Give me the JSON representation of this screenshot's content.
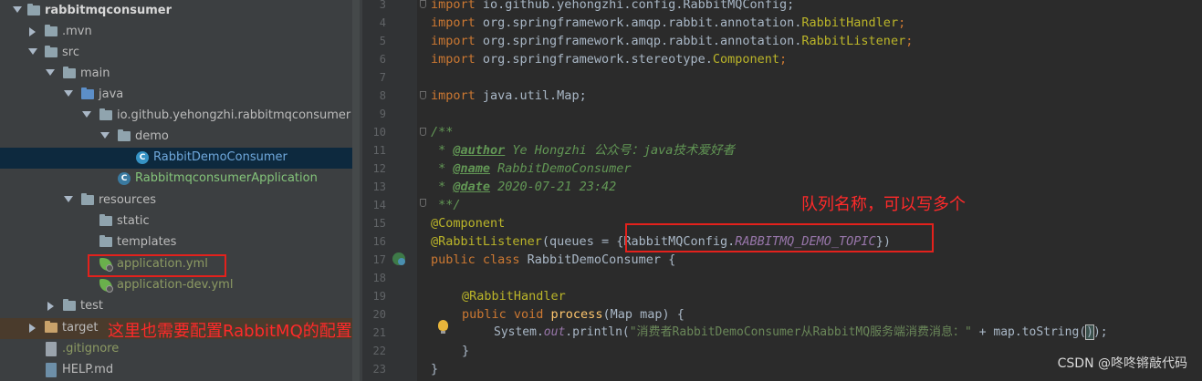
{
  "project_tree": {
    "items": [
      {
        "label": "rabbitmqconsumer",
        "bold": true
      },
      {
        "label": ".mvn"
      },
      {
        "label": "src"
      },
      {
        "label": "main"
      },
      {
        "label": "java"
      },
      {
        "label": "io.github.yehongzhi.rabbitmqconsumer"
      },
      {
        "label": "demo"
      },
      {
        "label": "RabbitDemoConsumer"
      },
      {
        "label": "RabbitmqconsumerApplication"
      },
      {
        "label": "resources"
      },
      {
        "label": "static"
      },
      {
        "label": "templates"
      },
      {
        "label": "application.yml"
      },
      {
        "label": "application-dev.yml"
      },
      {
        "label": "test"
      },
      {
        "label": "target"
      },
      {
        "label": ".gitignore"
      },
      {
        "label": "HELP.md"
      }
    ]
  },
  "editor": {
    "line_numbers": [
      "3",
      "4",
      "5",
      "6",
      "7",
      "8",
      "9",
      "10",
      "11",
      "12",
      "13",
      "14",
      "15",
      "16",
      "17",
      "18",
      "19",
      "20",
      "21",
      "22",
      "23"
    ],
    "code": {
      "l3_kw": "import ",
      "l3_pkg": "io.github.yehongzhi.config.RabbitMQConfig;",
      "l4_kw": "import ",
      "l4_pkg": "org.springframework.amqp.rabbit.annotation.",
      "l4_cls": "RabbitHandler",
      "l4_end": ";",
      "l5_kw": "import ",
      "l5_pkg": "org.springframework.amqp.rabbit.annotation.",
      "l5_cls": "RabbitListener",
      "l5_end": ";",
      "l6_kw": "import ",
      "l6_pkg": "org.springframework.stereotype.",
      "l6_cls": "Component",
      "l6_end": ";",
      "l8_kw": "import ",
      "l8_pkg": "java.util.Map;",
      "l10": "/**",
      "l11_pre": " * ",
      "l11_tag": "@author",
      "l11_val": " Ye Hongzhi 公众号：java技术爱好者",
      "l12_pre": " * ",
      "l12_tag": "@name",
      "l12_val": " RabbitDemoConsumer",
      "l13_pre": " * ",
      "l13_tag": "@date",
      "l13_val": " 2020-07-21 23:42",
      "l14": " **/",
      "l15": "@Component",
      "l16_ann": "@RabbitListener",
      "l16_mid": "(queues = {RabbitMQConfig.",
      "l16_fld": "RABBITMQ_DEMO_TOPIC",
      "l16_end": "})",
      "l17_kw": "public class ",
      "l17_name": "RabbitDemoConsumer {",
      "l19": "@RabbitHandler",
      "l20_kw": "public void ",
      "l20_fn": "process",
      "l20_rest": "(Map map) {",
      "l21_a": "System.",
      "l21_out": "out",
      "l21_b": ".println(",
      "l21_str": "\"消费者RabbitDemoConsumer从RabbitMQ服务端消费消息：\"",
      "l21_c": " + map.toString(",
      "l21_cur": ")",
      "l21_d": ");",
      "l22": "}",
      "l23": "}"
    }
  },
  "annotations": {
    "queue_note": "队列名称，可以写多个",
    "config_note": "这里也需要配置RabbitMQ的配置"
  },
  "watermark": "CSDN @咚咚锵敲代码"
}
